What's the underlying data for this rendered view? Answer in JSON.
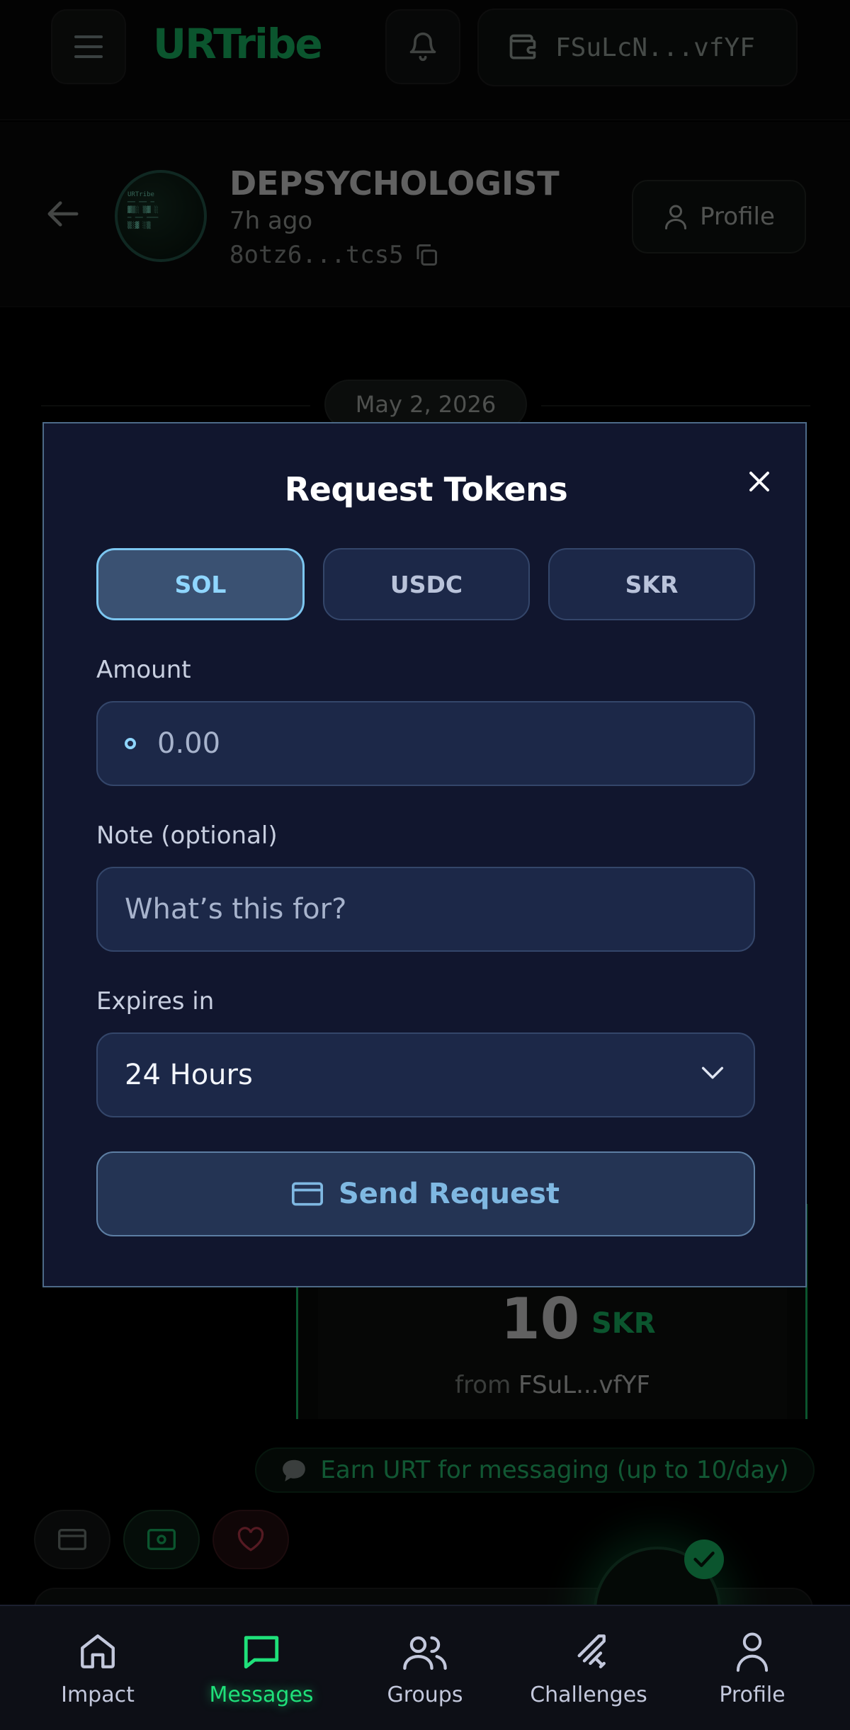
{
  "header": {
    "brand": "URTribe",
    "wallet_address": "FSuLcN...vfYF"
  },
  "chat": {
    "name": "DEPSYCHOLOGIST",
    "time": "7h ago",
    "address": "8otz6...tcs5",
    "profile_label": "Profile",
    "date_divider": "May 2, 2026",
    "token_message": {
      "amount": "10",
      "symbol": "SKR",
      "from_prefix": "from",
      "from_address": "FSuL...vfYF"
    },
    "earn_banner": "Earn URT for messaging (up to 10/day)"
  },
  "modal": {
    "title": "Request Tokens",
    "tokens": [
      {
        "label": "SOL",
        "selected": true
      },
      {
        "label": "USDC",
        "selected": false
      },
      {
        "label": "SKR",
        "selected": false
      }
    ],
    "amount_label": "Amount",
    "amount_placeholder": "0.00",
    "note_label": "Note (optional)",
    "note_placeholder": "What’s this for?",
    "expires_label": "Expires in",
    "expires_value": "24 Hours",
    "send_label": "Send Request"
  },
  "bottom_nav": {
    "items": [
      {
        "label": "Impact",
        "icon": "home-icon",
        "active": false
      },
      {
        "label": "Messages",
        "icon": "chat-icon",
        "active": true
      },
      {
        "label": "Groups",
        "icon": "users-icon",
        "active": false
      },
      {
        "label": "Challenges",
        "icon": "sword-icon",
        "active": false
      },
      {
        "label": "Profile",
        "icon": "user-icon",
        "active": false
      }
    ]
  },
  "colors": {
    "accent_green": "#1fe07a",
    "modal_bg": "#11162e",
    "selected_blue": "#8fd6ff"
  }
}
